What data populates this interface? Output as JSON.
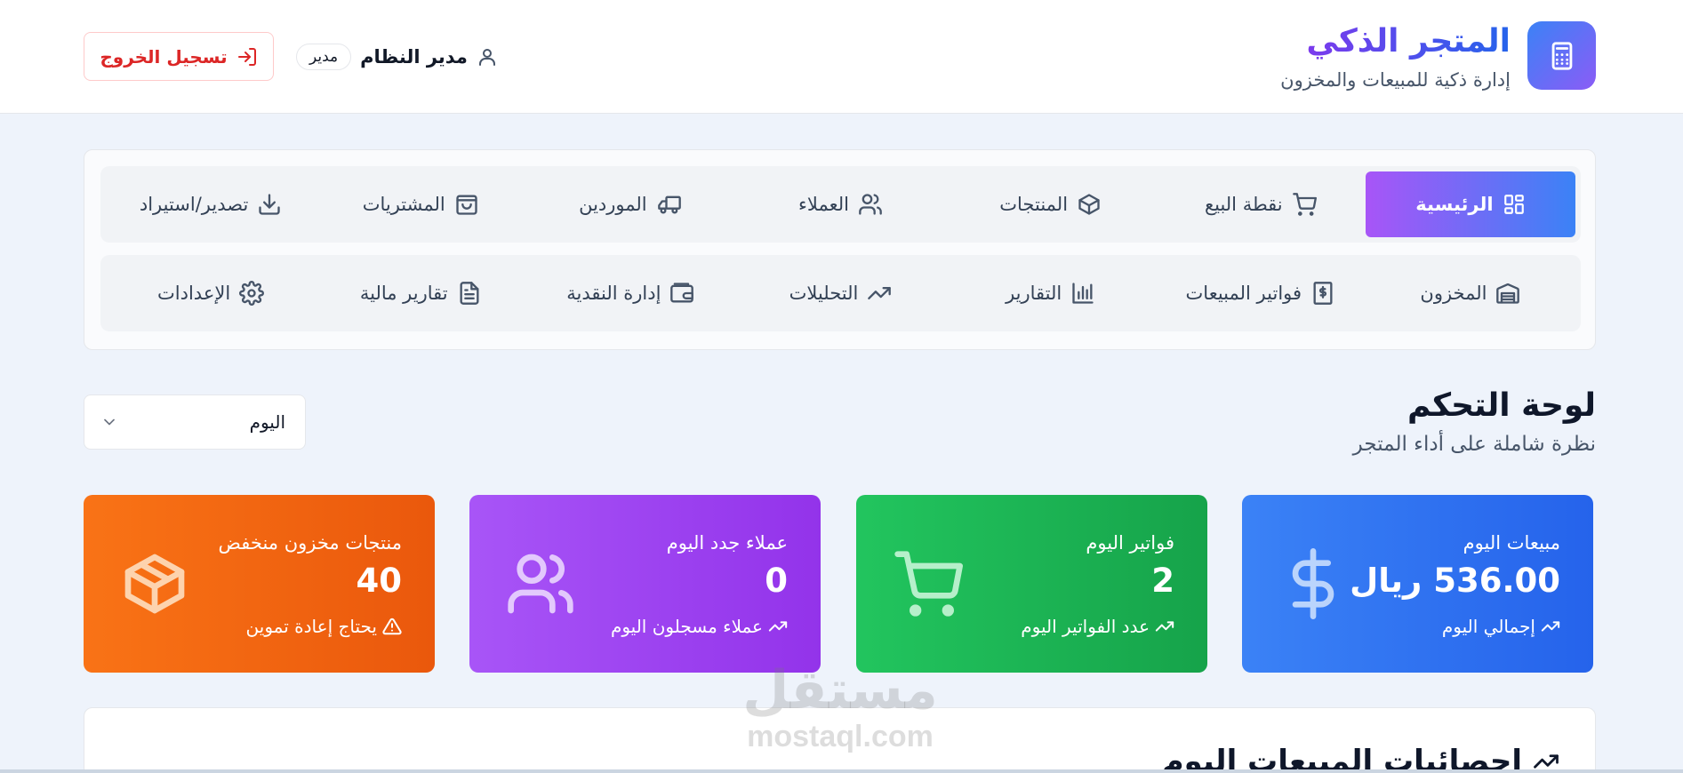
{
  "brand": {
    "title": "المتجر الذكي",
    "subtitle": "إدارة ذكية للمبيعات والمخزون",
    "logo_icon": "calculator-icon"
  },
  "user": {
    "name": "مدير النظام",
    "role": "مدير",
    "icon": "user-icon"
  },
  "logout": {
    "label": "تسجيل الخروج",
    "icon": "logout-icon"
  },
  "nav": {
    "row1": [
      {
        "label": "الرئيسية",
        "icon": "dashboard-grid-icon",
        "active": true
      },
      {
        "label": "نقطة البيع",
        "icon": "cart-icon"
      },
      {
        "label": "المنتجات",
        "icon": "package-icon"
      },
      {
        "label": "العملاء",
        "icon": "users-icon"
      },
      {
        "label": "الموردين",
        "icon": "truck-icon"
      },
      {
        "label": "المشتريات",
        "icon": "shopping-bag-icon"
      },
      {
        "label": "تصدير/استيراد",
        "icon": "download-icon"
      }
    ],
    "row2": [
      {
        "label": "المخزون",
        "icon": "warehouse-icon"
      },
      {
        "label": "فواتير المبيعات",
        "icon": "receipt-icon"
      },
      {
        "label": "التقارير",
        "icon": "bar-chart-icon"
      },
      {
        "label": "التحليلات",
        "icon": "trending-up-icon"
      },
      {
        "label": "إدارة النقدية",
        "icon": "wallet-icon"
      },
      {
        "label": "تقارير مالية",
        "icon": "file-text-icon"
      },
      {
        "label": "الإعدادات",
        "icon": "settings-icon"
      }
    ]
  },
  "dashboard": {
    "title": "لوحة التحكم",
    "subtitle": "نظرة شاملة على أداء المتجر",
    "period": "اليوم"
  },
  "cards": {
    "sales": {
      "label": "مبيعات اليوم",
      "value": "536.00 ريال",
      "note": "إجمالي اليوم",
      "color": "#3b82f6"
    },
    "invoices": {
      "label": "فواتير اليوم",
      "value": "2",
      "note": "عدد الفواتير اليوم",
      "color": "#22c55e"
    },
    "customers": {
      "label": "عملاء جدد اليوم",
      "value": "0",
      "note": "عملاء مسجلون اليوم",
      "color": "#a855f7"
    },
    "low_stock": {
      "label": "منتجات مخزون منخفض",
      "value": "40",
      "note": "يحتاج إعادة تموين",
      "color": "#f97316"
    }
  },
  "stats": {
    "title": "إحصائيات المبيعات اليوم"
  },
  "watermark": {
    "arabic": "مستقل",
    "latin": "mostaql.com"
  }
}
